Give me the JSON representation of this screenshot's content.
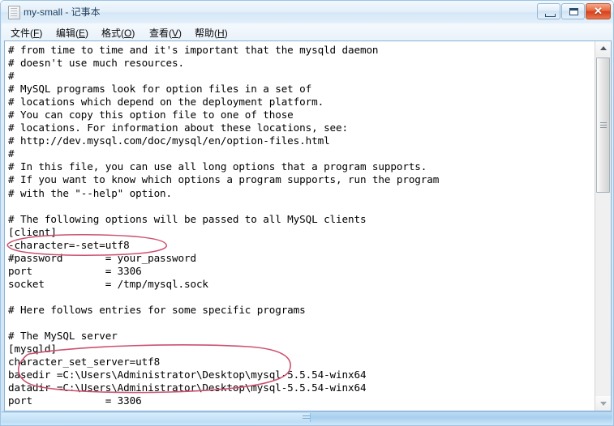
{
  "window": {
    "title": "my-small - 记事本",
    "icon": "notepad-document-icon",
    "controls": {
      "minimize_label": "—",
      "maximize_label": "□",
      "close_label": "✕"
    }
  },
  "menubar": {
    "items": [
      {
        "name": "file",
        "label": "文件(F)",
        "text": "文件",
        "mnemonic": "F"
      },
      {
        "name": "edit",
        "label": "编辑(E)",
        "text": "编辑",
        "mnemonic": "E"
      },
      {
        "name": "format",
        "label": "格式(O)",
        "text": "格式",
        "mnemonic": "O"
      },
      {
        "name": "view",
        "label": "查看(V)",
        "text": "查看",
        "mnemonic": "V"
      },
      {
        "name": "help",
        "label": "帮助(H)",
        "text": "帮助",
        "mnemonic": "H"
      }
    ]
  },
  "editor": {
    "content": "# from time to time and it's important that the mysqld daemon\n# doesn't use much resources.\n#\n# MySQL programs look for option files in a set of\n# locations which depend on the deployment platform.\n# You can copy this option file to one of those\n# locations. For information about these locations, see:\n# http://dev.mysql.com/doc/mysql/en/option-files.html\n#\n# In this file, you can use all long options that a program supports.\n# If you want to know which options a program supports, run the program\n# with the \"--help\" option.\n\n# The following options will be passed to all MySQL clients\n[client]\n-character=-set=utf8\n#password       = your_password\nport            = 3306\nsocket          = /tmp/mysql.sock\n\n# Here follows entries for some specific programs\n\n# The MySQL server\n[mysqld]\ncharacter_set_server=utf8\nbasedir =C:\\Users\\Administrator\\Desktop\\mysql-5.5.54-winx64\ndatadir =C:\\Users\\Administrator\\Desktop\\mysql-5.5.54-winx64\nport            = 3306",
    "lines": [
      "# from time to time and it's important that the mysqld daemon",
      "# doesn't use much resources.",
      "#",
      "# MySQL programs look for option files in a set of",
      "# locations which depend on the deployment platform.",
      "# You can copy this option file to one of those",
      "# locations. For information about these locations, see:",
      "# http://dev.mysql.com/doc/mysql/en/option-files.html",
      "#",
      "# In this file, you can use all long options that a program supports.",
      "# If you want to know which options a program supports, run the program",
      "# with the \"--help\" option.",
      "",
      "# The following options will be passed to all MySQL clients",
      "[client]",
      "-character=-set=utf8",
      "#password       = your_password",
      "port            = 3306",
      "socket          = /tmp/mysql.sock",
      "",
      "# Here follows entries for some specific programs",
      "",
      "# The MySQL server",
      "[mysqld]",
      "character_set_server=utf8",
      "basedir =C:\\Users\\Administrator\\Desktop\\mysql-5.5.54-winx64",
      "datadir =C:\\Users\\Administrator\\Desktop\\mysql-5.5.54-winx64",
      "port            = 3306"
    ]
  },
  "annotations": {
    "color": "#cc5270",
    "marks": [
      {
        "name": "ellipse-client-character-set",
        "target_text": "-character=-set=utf8",
        "shape": "ellipse"
      },
      {
        "name": "ellipse-mysqld-basedir-datadir",
        "target_text": "basedir / datadir paths",
        "shape": "ellipse"
      }
    ]
  },
  "scrollbars": {
    "vertical": {
      "up_arrow": "scroll-up-arrow",
      "down_arrow": "scroll-down-arrow",
      "thumb": "vertical-scroll-thumb"
    },
    "horizontal": {
      "thumb": "horizontal-scroll-thumb"
    }
  }
}
